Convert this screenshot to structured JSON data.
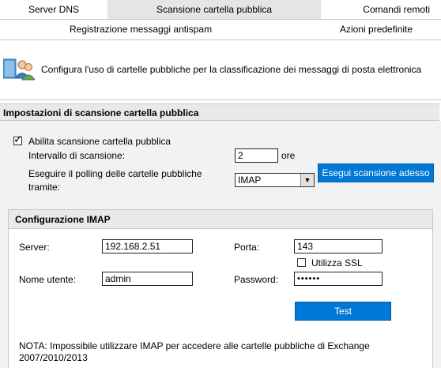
{
  "tabs_row1": [
    {
      "label": "Server DNS"
    },
    {
      "label": "Scansione cartella pubblica"
    },
    {
      "label": "Comandi remoti"
    }
  ],
  "tabs_row2": [
    {
      "label": "Registrazione messaggi antispam"
    },
    {
      "label": "Azioni predefinite"
    }
  ],
  "header": {
    "icon": "public-folder-users-icon",
    "description": "Configura l'uso di cartelle pubbliche per la classificazione dei messaggi di posta elettronica"
  },
  "scan_settings": {
    "title": "Impostazioni di scansione cartella pubblica",
    "enable_label": "Abilita scansione cartella pubblica",
    "enable_checked": true,
    "interval_label": "Intervallo di scansione:",
    "interval_value": "2",
    "interval_unit": "ore",
    "polling_label_line1": "Eseguire il polling delle cartelle pubbliche",
    "polling_label_line2": "tramite:",
    "polling_selected": "IMAP",
    "scan_now_button": "Esegui scansione adesso"
  },
  "imap": {
    "title": "Configurazione IMAP",
    "server_label": "Server:",
    "server_value": "192.168.2.51",
    "port_label": "Porta:",
    "port_value": "143",
    "ssl_label": "Utilizza SSL",
    "ssl_checked": false,
    "username_label": "Nome utente:",
    "username_value": "admin",
    "password_label": "Password:",
    "password_value": "••••••",
    "test_button": "Test",
    "note_line1": "NOTA: Impossibile utilizzare IMAP per accedere alle cartelle pubbliche di Exchange",
    "note_line2": "2007/2010/2013"
  },
  "colors": {
    "accent": "#0078d7",
    "active_tab": "#e5e5e5",
    "section_header": "#e9e9e9",
    "panel_bg": "#f2f2f2"
  }
}
